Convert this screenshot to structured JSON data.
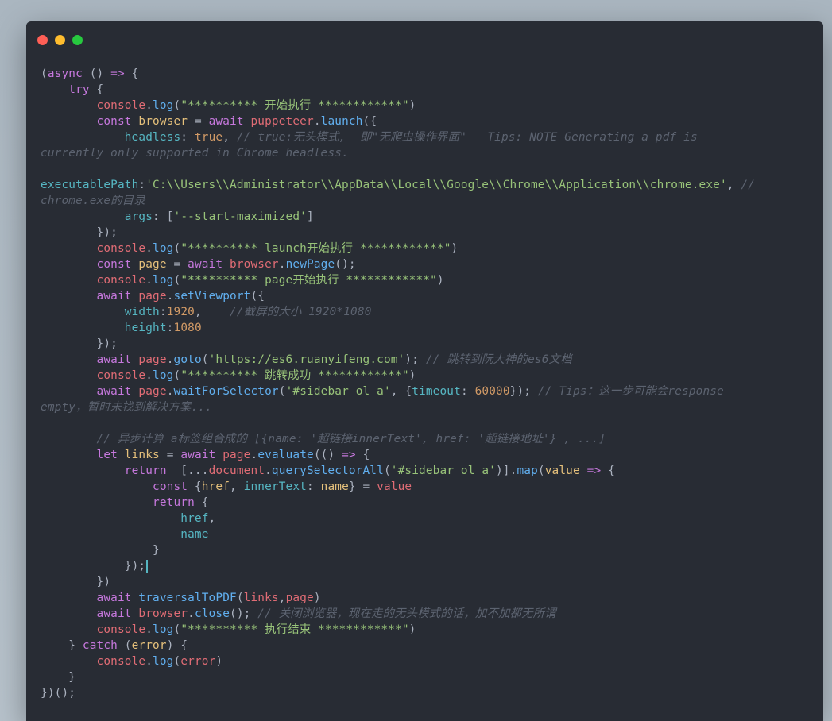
{
  "window": {
    "traffic_lights": [
      {
        "name": "close-button",
        "color": "#ff5f56"
      },
      {
        "name": "minimize-button",
        "color": "#ffbd2e"
      },
      {
        "name": "zoom-button",
        "color": "#27c93f"
      }
    ]
  },
  "code": {
    "lines": [
      [
        [
          "plain",
          "("
        ],
        [
          "keyword",
          "async"
        ],
        [
          "plain",
          " () "
        ],
        [
          "keyword",
          "=>"
        ],
        [
          "plain",
          " {"
        ]
      ],
      [
        [
          "plain",
          "    "
        ],
        [
          "keyword",
          "try"
        ],
        [
          "plain",
          " {"
        ]
      ],
      [
        [
          "plain",
          "        "
        ],
        [
          "param",
          "console"
        ],
        [
          "plain",
          "."
        ],
        [
          "function",
          "log"
        ],
        [
          "plain",
          "("
        ],
        [
          "string",
          "\"********** 开始执行 ************\""
        ],
        [
          "plain",
          ")"
        ]
      ],
      [
        [
          "plain",
          "        "
        ],
        [
          "keyword",
          "const"
        ],
        [
          "plain",
          " "
        ],
        [
          "variable",
          "browser"
        ],
        [
          "plain",
          " = "
        ],
        [
          "keyword",
          "await"
        ],
        [
          "plain",
          " "
        ],
        [
          "param",
          "puppeteer"
        ],
        [
          "plain",
          "."
        ],
        [
          "function",
          "launch"
        ],
        [
          "plain",
          "({"
        ]
      ],
      [
        [
          "plain",
          "            "
        ],
        [
          "property",
          "headless"
        ],
        [
          "plain",
          ": "
        ],
        [
          "number",
          "true"
        ],
        [
          "plain",
          ", "
        ],
        [
          "comment",
          "// true:无头模式,  即\"无爬虫操作界面\"   Tips: NOTE Generating a pdf is"
        ]
      ],
      [
        [
          "comment",
          "currently only supported in Chrome headless."
        ]
      ],
      [],
      [
        [
          "property",
          "executablePath"
        ],
        [
          "plain",
          ":"
        ],
        [
          "string",
          "'C:\\\\Users\\\\Administrator\\\\AppData\\\\Local\\\\Google\\\\Chrome\\\\Application\\\\chrome.exe'"
        ],
        [
          "plain",
          ", "
        ],
        [
          "comment",
          "//"
        ]
      ],
      [
        [
          "comment",
          "chrome.exe的目录"
        ]
      ],
      [
        [
          "plain",
          "            "
        ],
        [
          "property",
          "args"
        ],
        [
          "plain",
          ": ["
        ],
        [
          "string",
          "'--start-maximized'"
        ],
        [
          "plain",
          "]"
        ]
      ],
      [
        [
          "plain",
          "        });"
        ]
      ],
      [
        [
          "plain",
          "        "
        ],
        [
          "param",
          "console"
        ],
        [
          "plain",
          "."
        ],
        [
          "function",
          "log"
        ],
        [
          "plain",
          "("
        ],
        [
          "string",
          "\"********** launch开始执行 ************\""
        ],
        [
          "plain",
          ")"
        ]
      ],
      [
        [
          "plain",
          "        "
        ],
        [
          "keyword",
          "const"
        ],
        [
          "plain",
          " "
        ],
        [
          "variable",
          "page"
        ],
        [
          "plain",
          " = "
        ],
        [
          "keyword",
          "await"
        ],
        [
          "plain",
          " "
        ],
        [
          "param",
          "browser"
        ],
        [
          "plain",
          "."
        ],
        [
          "function",
          "newPage"
        ],
        [
          "plain",
          "();"
        ]
      ],
      [
        [
          "plain",
          "        "
        ],
        [
          "param",
          "console"
        ],
        [
          "plain",
          "."
        ],
        [
          "function",
          "log"
        ],
        [
          "plain",
          "("
        ],
        [
          "string",
          "\"********** page开始执行 ************\""
        ],
        [
          "plain",
          ")"
        ]
      ],
      [
        [
          "plain",
          "        "
        ],
        [
          "keyword",
          "await"
        ],
        [
          "plain",
          " "
        ],
        [
          "param",
          "page"
        ],
        [
          "plain",
          "."
        ],
        [
          "function",
          "setViewport"
        ],
        [
          "plain",
          "({"
        ]
      ],
      [
        [
          "plain",
          "            "
        ],
        [
          "property",
          "width"
        ],
        [
          "plain",
          ":"
        ],
        [
          "number",
          "1920"
        ],
        [
          "plain",
          ",    "
        ],
        [
          "comment",
          "//截屏的大小 1920*1080"
        ]
      ],
      [
        [
          "plain",
          "            "
        ],
        [
          "property",
          "height"
        ],
        [
          "plain",
          ":"
        ],
        [
          "number",
          "1080"
        ]
      ],
      [
        [
          "plain",
          "        });"
        ]
      ],
      [
        [
          "plain",
          "        "
        ],
        [
          "keyword",
          "await"
        ],
        [
          "plain",
          " "
        ],
        [
          "param",
          "page"
        ],
        [
          "plain",
          "."
        ],
        [
          "function",
          "goto"
        ],
        [
          "plain",
          "("
        ],
        [
          "string",
          "'https://es6.ruanyifeng.com'"
        ],
        [
          "plain",
          "); "
        ],
        [
          "comment",
          "// 跳转到阮大神的es6文档"
        ]
      ],
      [
        [
          "plain",
          "        "
        ],
        [
          "param",
          "console"
        ],
        [
          "plain",
          "."
        ],
        [
          "function",
          "log"
        ],
        [
          "plain",
          "("
        ],
        [
          "string",
          "\"********** 跳转成功 ************\""
        ],
        [
          "plain",
          ")"
        ]
      ],
      [
        [
          "plain",
          "        "
        ],
        [
          "keyword",
          "await"
        ],
        [
          "plain",
          " "
        ],
        [
          "param",
          "page"
        ],
        [
          "plain",
          "."
        ],
        [
          "function",
          "waitForSelector"
        ],
        [
          "plain",
          "("
        ],
        [
          "string",
          "'#sidebar ol a'"
        ],
        [
          "plain",
          ", {"
        ],
        [
          "property",
          "timeout"
        ],
        [
          "plain",
          ": "
        ],
        [
          "number",
          "60000"
        ],
        [
          "plain",
          "}); "
        ],
        [
          "comment",
          "// Tips：这一步可能会response"
        ]
      ],
      [
        [
          "comment",
          "empty，暂时未找到解决方案..."
        ]
      ],
      [],
      [
        [
          "plain",
          "        "
        ],
        [
          "comment",
          "// 异步计算 a标签组合成的 [{name: '超链接innerText', href: '超链接地址'} , ...]"
        ]
      ],
      [
        [
          "plain",
          "        "
        ],
        [
          "keyword",
          "let"
        ],
        [
          "plain",
          " "
        ],
        [
          "variable",
          "links"
        ],
        [
          "plain",
          " = "
        ],
        [
          "keyword",
          "await"
        ],
        [
          "plain",
          " "
        ],
        [
          "param",
          "page"
        ],
        [
          "plain",
          "."
        ],
        [
          "function",
          "evaluate"
        ],
        [
          "plain",
          "(() "
        ],
        [
          "keyword",
          "=>"
        ],
        [
          "plain",
          " {"
        ]
      ],
      [
        [
          "plain",
          "            "
        ],
        [
          "keyword",
          "return"
        ],
        [
          "plain",
          "  [..."
        ],
        [
          "param",
          "document"
        ],
        [
          "plain",
          "."
        ],
        [
          "function",
          "querySelectorAll"
        ],
        [
          "plain",
          "("
        ],
        [
          "string",
          "'#sidebar ol a'"
        ],
        [
          "plain",
          ")]."
        ],
        [
          "function",
          "map"
        ],
        [
          "plain",
          "("
        ],
        [
          "variable",
          "value"
        ],
        [
          "plain",
          " "
        ],
        [
          "keyword",
          "=>"
        ],
        [
          "plain",
          " {"
        ]
      ],
      [
        [
          "plain",
          "                "
        ],
        [
          "keyword",
          "const"
        ],
        [
          "plain",
          " {"
        ],
        [
          "variable",
          "href"
        ],
        [
          "plain",
          ", "
        ],
        [
          "property",
          "innerText"
        ],
        [
          "plain",
          ": "
        ],
        [
          "variable",
          "name"
        ],
        [
          "plain",
          "} = "
        ],
        [
          "param",
          "value"
        ]
      ],
      [
        [
          "plain",
          "                "
        ],
        [
          "keyword",
          "return"
        ],
        [
          "plain",
          " {"
        ]
      ],
      [
        [
          "plain",
          "                    "
        ],
        [
          "property",
          "href"
        ],
        [
          "plain",
          ","
        ]
      ],
      [
        [
          "plain",
          "                    "
        ],
        [
          "property",
          "name"
        ]
      ],
      [
        [
          "plain",
          "                }"
        ]
      ],
      [
        [
          "plain",
          "            });"
        ],
        [
          "caret",
          ""
        ]
      ],
      [
        [
          "plain",
          "        })"
        ]
      ],
      [
        [
          "plain",
          "        "
        ],
        [
          "keyword",
          "await"
        ],
        [
          "plain",
          " "
        ],
        [
          "function",
          "traversalToPDF"
        ],
        [
          "plain",
          "("
        ],
        [
          "param",
          "links"
        ],
        [
          "plain",
          ","
        ],
        [
          "param",
          "page"
        ],
        [
          "plain",
          ")"
        ]
      ],
      [
        [
          "plain",
          "        "
        ],
        [
          "keyword",
          "await"
        ],
        [
          "plain",
          " "
        ],
        [
          "param",
          "browser"
        ],
        [
          "plain",
          "."
        ],
        [
          "function",
          "close"
        ],
        [
          "plain",
          "(); "
        ],
        [
          "comment",
          "// 关闭浏览器，现在走的无头模式的话，加不加都无所谓"
        ]
      ],
      [
        [
          "plain",
          "        "
        ],
        [
          "param",
          "console"
        ],
        [
          "plain",
          "."
        ],
        [
          "function",
          "log"
        ],
        [
          "plain",
          "("
        ],
        [
          "string",
          "\"********** 执行结束 ************\""
        ],
        [
          "plain",
          ")"
        ]
      ],
      [
        [
          "plain",
          "    } "
        ],
        [
          "keyword",
          "catch"
        ],
        [
          "plain",
          " ("
        ],
        [
          "variable",
          "error"
        ],
        [
          "plain",
          ") {"
        ]
      ],
      [
        [
          "plain",
          "        "
        ],
        [
          "param",
          "console"
        ],
        [
          "plain",
          "."
        ],
        [
          "function",
          "log"
        ],
        [
          "plain",
          "("
        ],
        [
          "param",
          "error"
        ],
        [
          "plain",
          ")"
        ]
      ],
      [
        [
          "plain",
          "    }"
        ]
      ],
      [
        [
          "plain",
          "})();"
        ]
      ]
    ]
  }
}
